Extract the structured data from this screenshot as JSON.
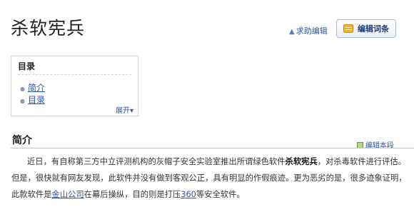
{
  "header": {
    "title": "杀软宪兵",
    "help_label": "求助编辑",
    "edit_button_label": "编辑词条"
  },
  "toc": {
    "heading": "目录",
    "items": [
      "简介",
      "目录"
    ],
    "expand_label": "展开"
  },
  "section": {
    "title": "简介",
    "edit_label": "编辑本段",
    "paragraph": {
      "part1": "近日，有自称第三方中立评测机构的灰帽子安全实验室推出所谓绿色软件",
      "bold": "杀软宪兵",
      "part2": "，对杀毒软件进行评估。但是，很快就有网友发现，此软件并没有做到客观公正，具有明显的作假痕迹。更为恶劣的是，很多迹象证明，此款软件是",
      "link1": "金山公司",
      "part3": "在幕后操纵，目的则是打压",
      "link2": "360",
      "part4": "等安全软件。"
    }
  },
  "colors": {
    "link": "#2a55a8",
    "border": "#cfd7e3",
    "edit_button_text": "#1f3d7a"
  },
  "icons": {
    "help": "help-icon",
    "edit_button": "edit-entry-icon",
    "section_edit": "edit-section-icon",
    "toc_bullet": "bullet-icon"
  }
}
